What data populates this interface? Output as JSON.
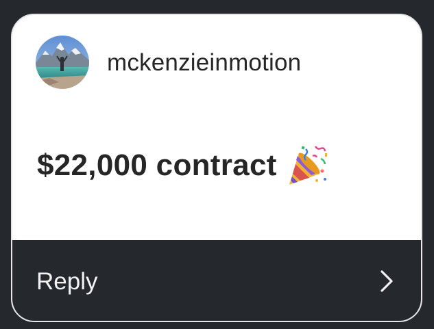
{
  "notification": {
    "username": "mckenzieinmotion",
    "avatar_icon": "profile-photo-mountain-lake",
    "message": "$22,000 contract",
    "emoji_icon": "party-popper-icon",
    "reply_label": "Reply",
    "reply_icon": "chevron-right-icon"
  },
  "colors": {
    "background": "#25282d",
    "card": "#ffffff",
    "text": "#262626",
    "reply_text": "#f2f2f2"
  }
}
